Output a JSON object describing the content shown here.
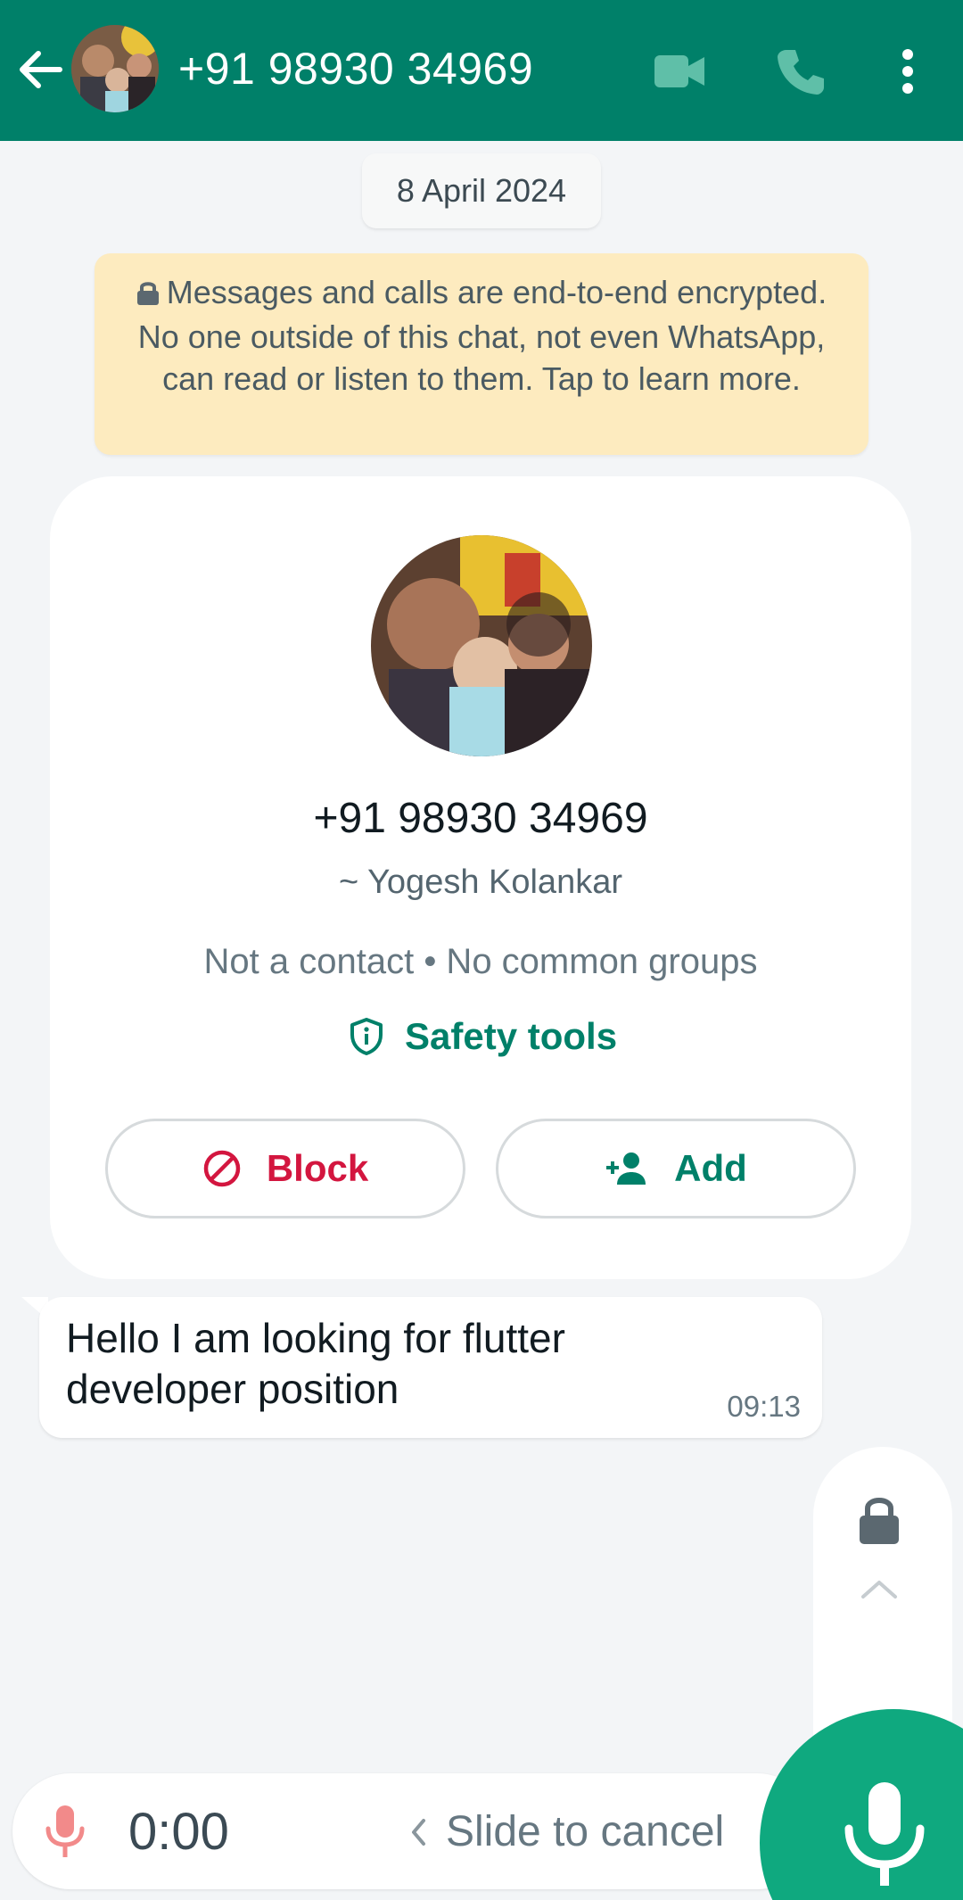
{
  "header": {
    "title": "+91 98930 34969",
    "icons": [
      "back-arrow-icon",
      "video-call-icon",
      "voice-call-icon",
      "more-options-icon"
    ]
  },
  "date_chip": "8 April 2024",
  "encryption_notice": "Messages and calls are end-to-end encrypted. No one outside of this chat, not even WhatsApp, can read or listen to them. Tap to learn more.",
  "profile": {
    "phone": "+91 98930 34969",
    "name": "~ Yogesh Kolankar",
    "meta": "Not a contact • No common groups",
    "safety_label": "Safety tools",
    "block_label": "Block",
    "add_label": "Add"
  },
  "message": {
    "text": "Hello I am looking for flutter developer position",
    "time": "09:13"
  },
  "recording": {
    "timer": "0:00",
    "slide_text": "Slide to cancel"
  },
  "colors": {
    "header": "#008069",
    "accent_green": "#008069",
    "block_red": "#d3163f",
    "mic_button": "#0fa97f",
    "notice_bg": "#fdebbf"
  }
}
